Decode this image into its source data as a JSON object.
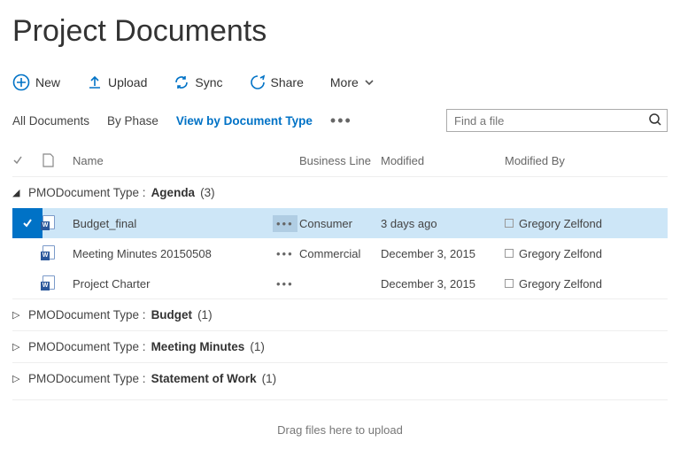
{
  "page_title": "Project Documents",
  "toolbar": {
    "new_label": "New",
    "upload_label": "Upload",
    "sync_label": "Sync",
    "share_label": "Share",
    "more_label": "More"
  },
  "views": {
    "items": [
      {
        "label": "All Documents",
        "active": false
      },
      {
        "label": "By Phase",
        "active": false
      },
      {
        "label": "View by Document Type",
        "active": true
      }
    ]
  },
  "search": {
    "placeholder": "Find a file"
  },
  "columns": {
    "name": "Name",
    "business_line": "Business Line",
    "modified": "Modified",
    "modified_by": "Modified By"
  },
  "group_prefix": "PMODocument Type",
  "groups": [
    {
      "label": "Agenda",
      "count": "(3)",
      "expanded": true,
      "rows": [
        {
          "name": "Budget_final",
          "business_line": "Consumer",
          "modified": "3 days ago",
          "modified_by": "Gregory Zelfond",
          "selected": true
        },
        {
          "name": "Meeting Minutes 20150508",
          "business_line": "Commercial",
          "modified": "December 3, 2015",
          "modified_by": "Gregory Zelfond",
          "selected": false
        },
        {
          "name": "Project Charter",
          "business_line": "",
          "modified": "December 3, 2015",
          "modified_by": "Gregory Zelfond",
          "selected": false
        }
      ]
    },
    {
      "label": "Budget",
      "count": "(1)",
      "expanded": false,
      "rows": []
    },
    {
      "label": "Meeting Minutes",
      "count": "(1)",
      "expanded": false,
      "rows": []
    },
    {
      "label": "Statement of Work",
      "count": "(1)",
      "expanded": false,
      "rows": []
    }
  ],
  "drop_hint": "Drag files here to upload"
}
